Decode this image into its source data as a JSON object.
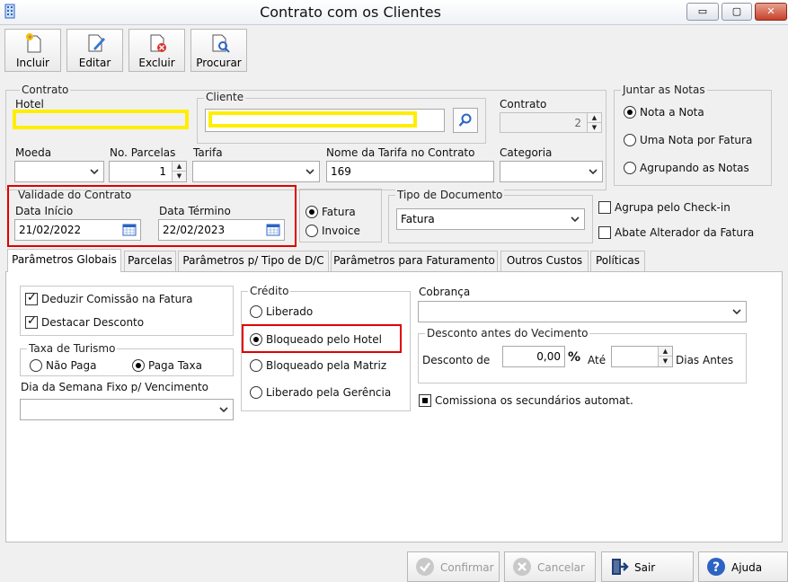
{
  "window": {
    "title": "Contrato com os Clientes",
    "minimize": "▭",
    "maximize": "▢",
    "close": "✕"
  },
  "toolbar": {
    "include": "Incluir",
    "edit": "Editar",
    "delete": "Excluir",
    "search": "Procurar"
  },
  "contract_group": {
    "legend": "Contrato",
    "hotel_label": "Hotel",
    "hotel_value": "",
    "client_legend": "Cliente",
    "client_value": "",
    "contract_label": "Contrato",
    "contract_value": "2"
  },
  "join_notes": {
    "legend": "Juntar as Notas",
    "options": [
      "Nota a Nota",
      "Uma Nota por Fatura",
      "Agrupando as Notas"
    ],
    "selected": "Nota a Nota"
  },
  "row2": {
    "currency_label": "Moeda",
    "currency_value": "",
    "installments_label": "No. Parcelas",
    "installments_value": "1",
    "tariff_label": "Tarifa",
    "tariff_value": "",
    "tariff_name_label": "Nome da Tarifa no Contrato",
    "tariff_name_value": "169",
    "category_label": "Categoria",
    "category_value": ""
  },
  "validity": {
    "legend": "Validade do Contrato",
    "start_label": "Data Início",
    "start_value": "21/02/2022",
    "end_label": "Data Término",
    "end_value": "22/02/2023"
  },
  "billing_type": {
    "options": [
      "Fatura",
      "Invoice"
    ],
    "selected": "Fatura"
  },
  "doc_type": {
    "legend": "Tipo de Documento",
    "value": "Fatura"
  },
  "flags": {
    "group_checkin": "Agrupa pelo Check-in",
    "reduce_changer": "Abate Alterador da Fatura"
  },
  "tabs": [
    "Parâmetros Globais",
    "Parcelas",
    "Parâmetros p/ Tipo de D/C",
    "Parâmetros para Faturamento",
    "Outros Custos",
    "Políticas"
  ],
  "globals": {
    "deduct_commission": "Deduzir Comissão na Fatura",
    "highlight_discount": "Destacar Desconto",
    "tourism_tax_legend": "Taxa de Turismo",
    "tourism_not_paid": "Não Paga",
    "tourism_pays": "Paga Taxa",
    "tourism_selected": "Paga Taxa",
    "fixed_day_label": "Dia da Semana Fixo p/ Vencimento",
    "fixed_day_value": ""
  },
  "credit": {
    "legend": "Crédito",
    "options": [
      "Liberado",
      "Bloqueado pelo Hotel",
      "Bloqueado pela Matriz",
      "Liberado pela Gerência"
    ],
    "selected": "Bloqueado pelo Hotel"
  },
  "billing": {
    "label": "Cobrança",
    "value": "",
    "discount_legend": "Desconto antes do Vecimento",
    "discount_label": "Desconto de",
    "discount_value": "0,00",
    "percent": "%",
    "until_label": "Até",
    "days_value": "",
    "days_label": "Dias Antes",
    "secondary_commission": "Comissiona os secundários automat."
  },
  "footer": {
    "confirm": "Confirmar",
    "cancel": "Cancelar",
    "exit": "Sair",
    "help": "Ajuda"
  },
  "colors": {
    "highlight_yellow": "#ffee00",
    "highlight_red": "#e00000",
    "help_blue": "#2c63c4"
  }
}
